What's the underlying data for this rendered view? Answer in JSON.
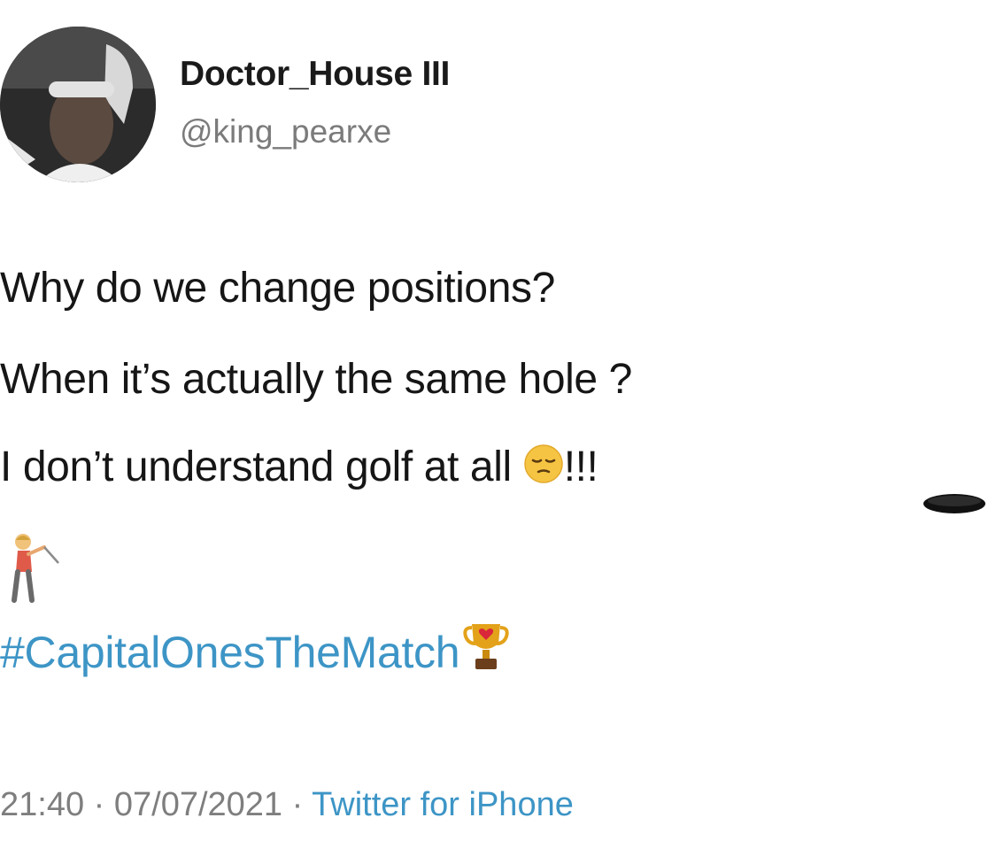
{
  "author": {
    "display_name": "Doctor_House III",
    "handle": "@king_pearxe"
  },
  "tweet": {
    "lines": [
      "Why do we change positions?",
      "When it’s actually the same hole ?",
      "I don’t understand golf at all"
    ],
    "line3_suffix": "!!!",
    "hashtag": "#CapitalOnesTheMatch",
    "icons": [
      "pensive-face-emoji",
      "hole-emoji",
      "golfer-emoji",
      "trophy-emoji"
    ]
  },
  "meta": {
    "time": "21:40",
    "separator": " · ",
    "date": "07/07/2021",
    "source": "Twitter for iPhone"
  },
  "colors": {
    "link": "#3d95c6",
    "secondary_text": "#7b7b7b",
    "primary_text": "#161616"
  }
}
